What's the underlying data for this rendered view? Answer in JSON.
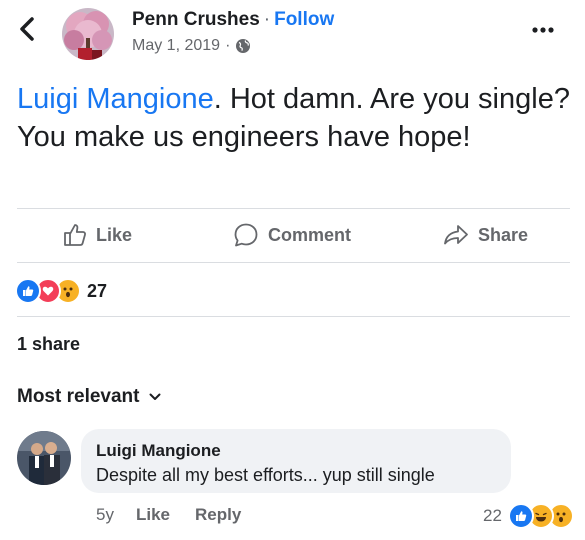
{
  "header": {
    "page_name": "Penn Crushes",
    "separator": "·",
    "follow_label": "Follow",
    "date": "May 1, 2019",
    "privacy_icon": "globe-icon",
    "back_icon": "chevron-left-icon",
    "more_icon": "more-dots-icon"
  },
  "post": {
    "mention": "Luigi Mangione",
    "text": ". Hot damn. Are you single? You make us engineers have hope!"
  },
  "actions": {
    "like_label": "Like",
    "comment_label": "Comment",
    "share_label": "Share"
  },
  "reactions": {
    "types": [
      "like",
      "love",
      "wow"
    ],
    "count": "27"
  },
  "shares_text": "1 share",
  "sort_label": "Most relevant",
  "comment": {
    "author": "Luigi Mangione",
    "text": "Despite all my best efforts... yup still single",
    "age": "5y",
    "like_label": "Like",
    "reply_label": "Reply",
    "reaction_count": "22",
    "reaction_types": [
      "like",
      "haha",
      "wow"
    ]
  },
  "colors": {
    "accent": "#1877f2",
    "secondary_text": "#65676b",
    "bubble": "#f0f2f5",
    "love": "#f33e58",
    "wow": "#f7b125"
  }
}
